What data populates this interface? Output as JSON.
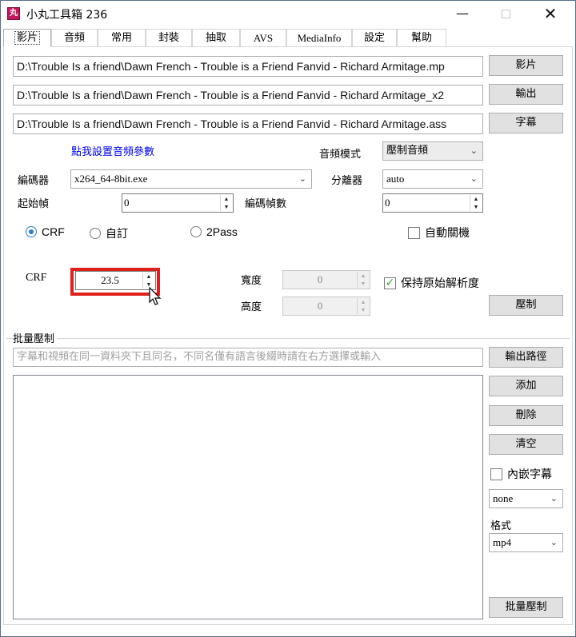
{
  "window": {
    "title": "小丸工具箱 236",
    "icon_text": "丸",
    "controls": {
      "minimize": "—",
      "maximize": "",
      "close": "✕"
    }
  },
  "tabs": [
    "影片",
    "音頻",
    "常用",
    "封裝",
    "抽取",
    "AVS",
    "MediaInfo",
    "設定",
    "幫助"
  ],
  "files": {
    "video_path": "D:\\Trouble Is a friend\\Dawn French - Trouble is a Friend Fanvid - Richard Armitage.mp",
    "output_path": "D:\\Trouble Is a friend\\Dawn French - Trouble is a Friend Fanvid - Richard Armitage_x2",
    "subtitle_path": "D:\\Trouble Is a friend\\Dawn French - Trouble is a Friend Fanvid - Richard Armitage.ass",
    "video_btn": "影片",
    "output_btn": "輸出",
    "subtitle_btn": "字幕"
  },
  "settings": {
    "audio_link": "點我設置音頻參數",
    "audio_mode_label": "音頻模式",
    "audio_mode_value": "壓制音頻",
    "encoder_label": "編碼器",
    "encoder_value": "x264_64-8bit.exe",
    "demuxer_label": "分離器",
    "demuxer_value": "auto",
    "start_frame_label": "起始幀",
    "start_frame_value": "0",
    "frame_count_label": "編碼幀數",
    "frame_count_value": "0",
    "radio_crf": "CRF",
    "radio_custom": "自訂",
    "radio_2pass": "2Pass",
    "auto_shutdown": "自動關機",
    "crf_label": "CRF",
    "crf_value": "23.5",
    "width_label": "寬度",
    "width_value": "0",
    "height_label": "高度",
    "height_value": "0",
    "keep_resolution": "保持原始解析度",
    "encode_btn": "壓制"
  },
  "batch": {
    "group_label": "批量壓制",
    "hint_text": "字幕和視頻在同一資料夾下且同名，不同名僅有語言後綴時請在右方選擇或輸入",
    "output_path_btn": "輸出路徑",
    "add_btn": "添加",
    "delete_btn": "刪除",
    "clear_btn": "清空",
    "embed_subs": "內嵌字幕",
    "subs_select": "none",
    "format_label": "格式",
    "format_value": "mp4",
    "batch_encode_btn": "批量壓制"
  },
  "colors": {
    "accent_radio": "#2c7ad6",
    "check_green": "#2e9c2e",
    "highlight_red": "#e0201a",
    "link_blue": "#0000ee"
  }
}
